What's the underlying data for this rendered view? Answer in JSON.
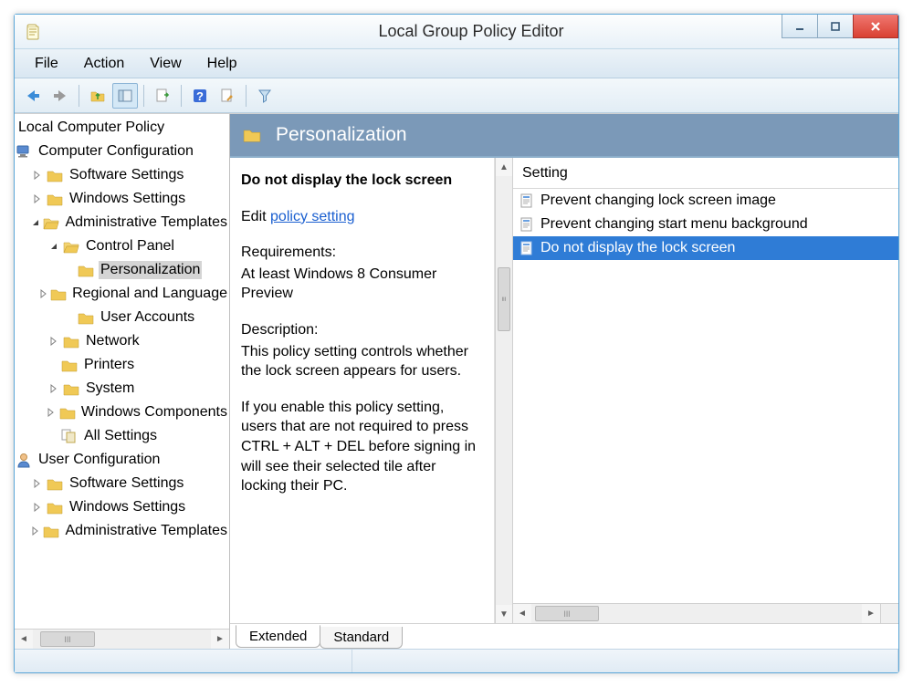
{
  "window": {
    "title": "Local Group Policy Editor"
  },
  "menu": {
    "file": "File",
    "action": "Action",
    "view": "View",
    "help": "Help"
  },
  "tree": {
    "root": "Local Computer Policy",
    "computer_config": "Computer Configuration",
    "software_settings1": "Software Settings",
    "windows_settings1": "Windows Settings",
    "admin_templates1": "Administrative Templates",
    "control_panel": "Control Panel",
    "personalization": "Personalization",
    "regional": "Regional and Language",
    "user_accounts": "User Accounts",
    "network": "Network",
    "printers": "Printers",
    "system": "System",
    "windows_components": "Windows Components",
    "all_settings": "All Settings",
    "user_config": "User Configuration",
    "software_settings2": "Software Settings",
    "windows_settings2": "Windows Settings",
    "admin_templates2": "Administrative Templates"
  },
  "category": {
    "title": "Personalization"
  },
  "policy": {
    "name": "Do not display the lock screen",
    "edit_label": "Edit",
    "edit_link": "policy setting",
    "req_label": "Requirements:",
    "req_text": "At least Windows 8 Consumer Preview",
    "desc_label": "Description:",
    "desc_text1": "This policy setting controls whether the lock screen appears for users.",
    "desc_text2": "If you enable this policy setting, users that are not required to press CTRL + ALT + DEL before signing in will see their selected tile after locking their PC."
  },
  "list": {
    "header": "Setting",
    "items": [
      "Prevent changing lock screen image",
      "Prevent changing start menu background",
      "Do not display the lock screen"
    ],
    "selected_index": 2
  },
  "tabs": {
    "extended": "Extended",
    "standard": "Standard"
  }
}
